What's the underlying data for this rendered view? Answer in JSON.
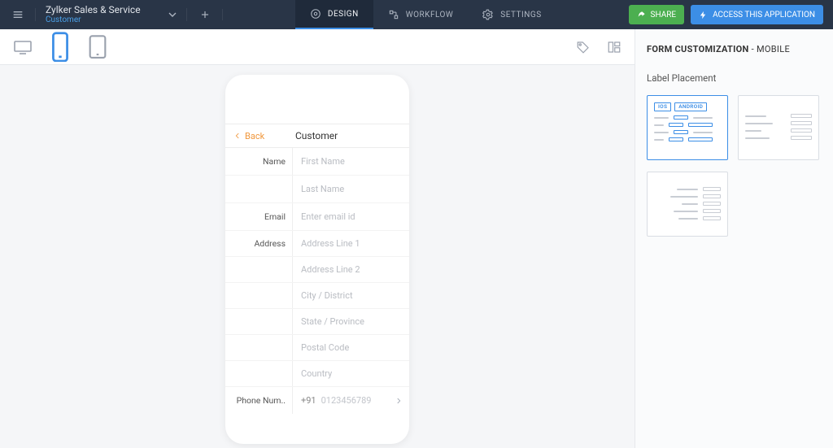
{
  "app": {
    "title": "Zylker Sales & Service",
    "subtitle": "Customer"
  },
  "topnav": {
    "design": "DESIGN",
    "workflow": "WORKFLOW",
    "settings": "SETTINGS"
  },
  "actions": {
    "share": "SHARE",
    "access": "ACCESS THIS APPLICATION"
  },
  "form_preview": {
    "back_label": "Back",
    "title": "Customer",
    "fields": {
      "name_label": "Name",
      "first_name_ph": "First Name",
      "last_name_ph": "Last Name",
      "email_label": "Email",
      "email_ph": "Enter email id",
      "address_label": "Address",
      "addr1_ph": "Address Line 1",
      "addr2_ph": "Address Line 2",
      "city_ph": "City / District",
      "state_ph": "State / Province",
      "postal_ph": "Postal Code",
      "country_ph": "Country",
      "phone_label": "Phone Num..",
      "phone_prefix": "+91",
      "phone_ph": "0123456789"
    }
  },
  "right_panel": {
    "title_bold": "FORM CUSTOMIZATION",
    "title_rest": " - MOBILE",
    "section1": "Label Placement",
    "os_ios": "IOS",
    "os_android": "ANDROID"
  }
}
